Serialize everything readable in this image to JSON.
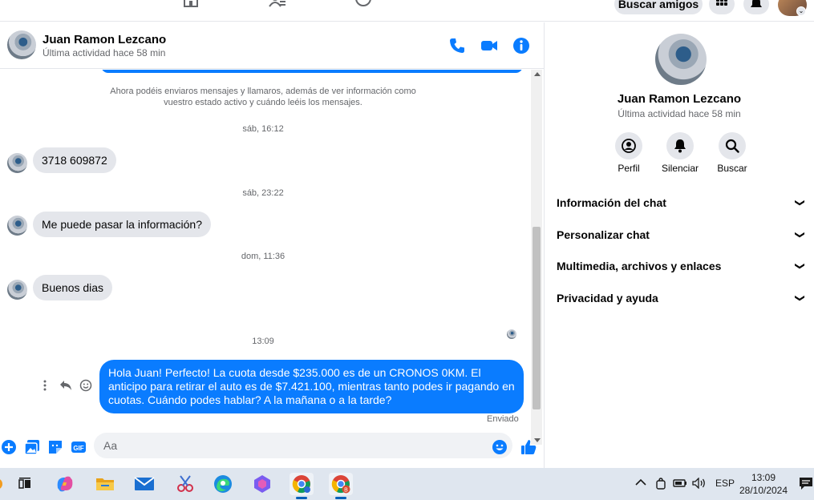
{
  "topnav": {
    "find_friends": "Buscar amigos"
  },
  "chat": {
    "contact_name": "Juan Ramon Lezcano",
    "contact_status": "Última actividad hace 58 min",
    "system_note": "Ahora podéis enviaros mensajes y llamaros, además de ver información como vuestro estado activo y cuándo leéis los mensajes.",
    "messages": [
      {
        "time": "sáb, 16:12",
        "text": "3718 609872"
      },
      {
        "time": "sáb, 23:22",
        "text": "Me puede pasar la información?"
      },
      {
        "time": "dom, 11:36",
        "text": "Buenos dias"
      }
    ],
    "outgoing": {
      "time": "13:09",
      "text": "Hola Juan! Perfecto! La cuota desde $235.000 es de un CRONOS 0KM. El anticipo para retirar el auto es de $7.421.100, mientras tanto podes ir pagando en cuotas. Cuándo podes hablar? A la mañana o a la tarde?",
      "status": "Enviado"
    },
    "composer_placeholder": "Aa"
  },
  "sidebar": {
    "name": "Juan Ramon Lezcano",
    "status": "Última actividad hace 58 min",
    "actions": [
      {
        "label": "Perfil",
        "icon": "profile-icon"
      },
      {
        "label": "Silenciar",
        "icon": "bell-icon"
      },
      {
        "label": "Buscar",
        "icon": "search-icon"
      }
    ],
    "sections": [
      "Información del chat",
      "Personalizar chat",
      "Multimedia, archivos y enlaces",
      "Privacidad y ayuda"
    ]
  },
  "taskbar": {
    "language": "ESP",
    "time": "13:09",
    "date": "28/10/2024"
  },
  "colors": {
    "accent": "#0a7cff",
    "incoming_bubble": "#e4e6eb",
    "taskbar": "#dfe6ef"
  }
}
